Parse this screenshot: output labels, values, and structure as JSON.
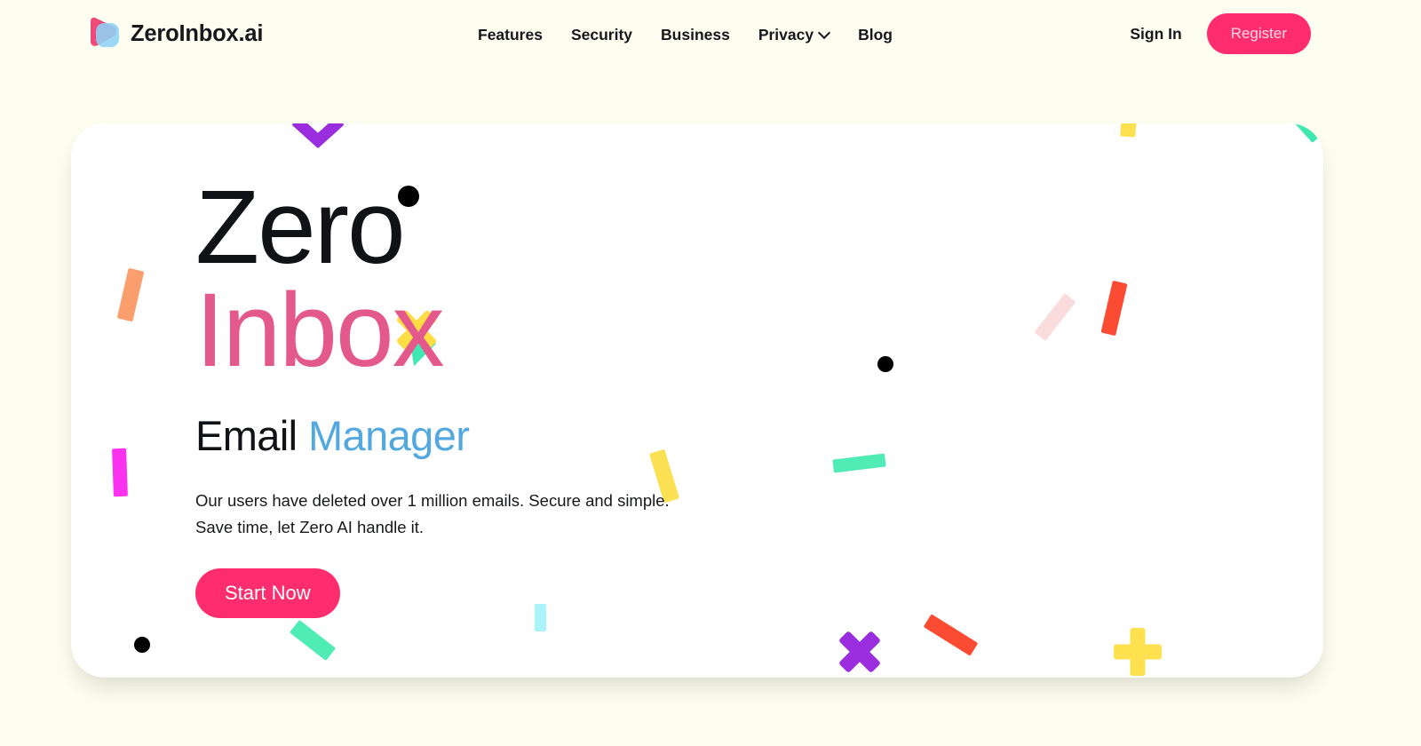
{
  "page": {
    "background_color": "#fdfdf0",
    "card_background": "#ffffff"
  },
  "header": {
    "brand": {
      "name": "ZeroInbox.ai",
      "logo_icon": "zeroinbox-logo-icon",
      "logo_colors": {
        "pink": "#ef4a78",
        "blue": "#8ed3f5",
        "overlap": "#7a95cf"
      }
    },
    "nav": [
      {
        "label": "Features",
        "has_dropdown": false
      },
      {
        "label": "Security",
        "has_dropdown": false
      },
      {
        "label": "Business",
        "has_dropdown": false
      },
      {
        "label": "Privacy",
        "has_dropdown": true,
        "dropdown_icon": "chevron-down-icon"
      },
      {
        "label": "Blog",
        "has_dropdown": false
      }
    ],
    "auth": {
      "sign_in_label": "Sign In",
      "register_label": "Register",
      "register_color": "#ff2d6f"
    }
  },
  "hero": {
    "title_line1": "Zero",
    "title_line2": "Inbox",
    "title_line1_color": "#111216",
    "title_line2_color": "#e4598b",
    "subtitle_plain": "Email",
    "subtitle_accent": "Manager",
    "subtitle_accent_color": "#54a8e0",
    "lede_line1": "Our users have deleted over 1 million emails. Secure and simple.",
    "lede_line2": "Save time, let Zero AI handle it.",
    "cta_label": "Start Now",
    "cta_color": "#ff2d6f"
  },
  "decorations": [
    {
      "name": "purple-chevron-top",
      "shape": "chevron",
      "color": "#9a2ede"
    },
    {
      "name": "yellow-bar-top-right",
      "shape": "bar",
      "color": "#ffe14f"
    },
    {
      "name": "teal-wedge-top-right",
      "shape": "bar",
      "color": "#3fe8b0"
    },
    {
      "name": "orange-bar-left",
      "shape": "bar",
      "color": "#fb9e6e"
    },
    {
      "name": "magenta-bar-left",
      "shape": "bar",
      "color": "#fb33f0"
    },
    {
      "name": "black-dot-headline",
      "shape": "dot",
      "color": "#000000"
    },
    {
      "name": "yellow-cross-inbox",
      "shape": "cross",
      "color": "#ffdd45"
    },
    {
      "name": "green-triangle-inbox",
      "shape": "triangle",
      "color": "#3fe8b0"
    },
    {
      "name": "pale-pink-bar-right",
      "shape": "bar",
      "color": "#fbdcdc"
    },
    {
      "name": "red-bar-right",
      "shape": "bar",
      "color": "#fb4b33"
    },
    {
      "name": "black-dot-center",
      "shape": "dot",
      "color": "#000000"
    },
    {
      "name": "mint-bar-center",
      "shape": "bar",
      "color": "#4fecb5"
    },
    {
      "name": "yellow-bar-mid",
      "shape": "bar",
      "color": "#fbe053"
    },
    {
      "name": "cyan-bar-bottom",
      "shape": "bar",
      "color": "#aaf3f9"
    },
    {
      "name": "mint-bar-cta",
      "shape": "bar",
      "color": "#4fecb5"
    },
    {
      "name": "black-dot-bottom-left",
      "shape": "dot",
      "color": "#000000"
    },
    {
      "name": "purple-cross-bottom",
      "shape": "cross",
      "color": "#9a2ede"
    },
    {
      "name": "red-bar-bottom",
      "shape": "bar",
      "color": "#fb4b33"
    },
    {
      "name": "yellow-plus-bottom",
      "shape": "plus",
      "color": "#ffe14f"
    }
  ]
}
